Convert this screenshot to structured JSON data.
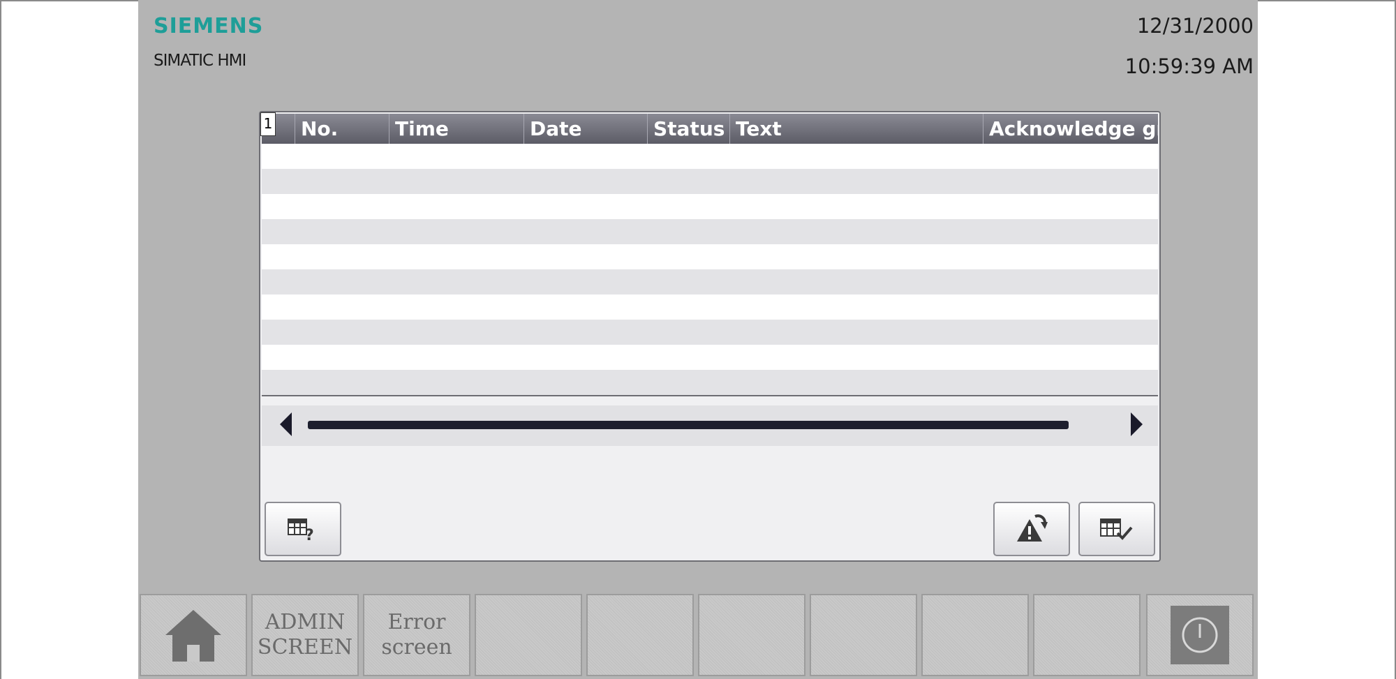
{
  "header": {
    "brand": "SIEMENS",
    "product": "SIMATIC HMI",
    "date": "12/31/2000",
    "time": "10:59:39 AM"
  },
  "alarm_view": {
    "index": "1",
    "columns": [
      "No.",
      "Time",
      "Date",
      "Status",
      "Text",
      "Acknowledge gr"
    ],
    "rows": [],
    "empty_row_count": 11,
    "buttons": {
      "info_icon": "table-question-icon",
      "acknowledge_icon": "warning-acknowledge-icon",
      "edit_icon": "table-check-icon"
    }
  },
  "function_keys": [
    {
      "label": "",
      "icon": "home-icon"
    },
    {
      "label": "ADMIN\nSCREEN"
    },
    {
      "label": "Error\nscreen"
    },
    {
      "label": ""
    },
    {
      "label": ""
    },
    {
      "label": ""
    },
    {
      "label": ""
    },
    {
      "label": ""
    },
    {
      "label": ""
    },
    {
      "label": "",
      "icon": "power-icon"
    }
  ],
  "colors": {
    "brand": "#1e9e98",
    "screen_background": "#b4b4b4",
    "header_gradient": "#5c5c66"
  }
}
